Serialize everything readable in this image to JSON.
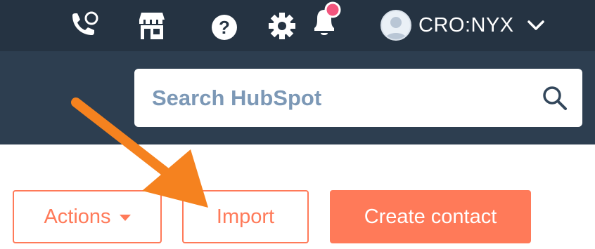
{
  "header": {
    "account_name": "CRO:NYX",
    "icons": [
      "phone-icon",
      "marketplace-icon",
      "help-icon",
      "settings-icon",
      "notifications-icon",
      "avatar",
      "chevron-down-icon"
    ],
    "notification_dot_color": "#f2547d"
  },
  "search": {
    "placeholder": "Search HubSpot",
    "value": ""
  },
  "toolbar": {
    "actions_label": "Actions",
    "import_label": "Import",
    "create_label": "Create contact"
  },
  "colors": {
    "topbar": "#253342",
    "subbar": "#2d3e50",
    "accent": "#ff7a59",
    "annotation_arrow": "#f5821f"
  }
}
